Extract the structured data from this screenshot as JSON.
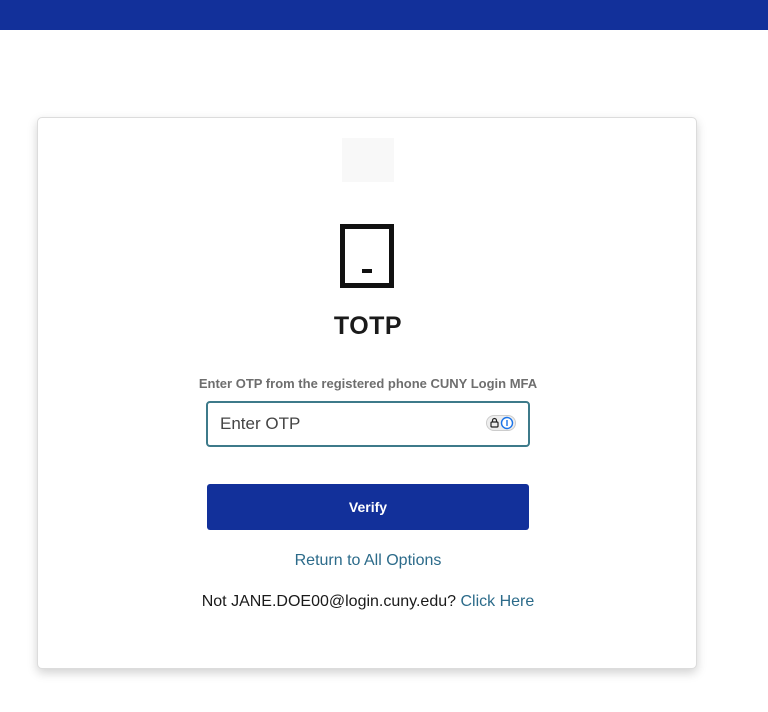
{
  "colors": {
    "brand": "#12309a",
    "link": "#2c6b8a",
    "input_border": "#3d7a8a"
  },
  "card": {
    "logo_icon": "blank-logo-placeholder",
    "device_icon": "tablet-phone-icon",
    "title": "TOTP",
    "instruction": "Enter OTP from the registered phone CUNY Login MFA",
    "otp_input": {
      "placeholder": "Enter OTP",
      "value": "",
      "icon": "password-manager-icon"
    },
    "verify_label": "Verify",
    "return_link": "Return to All Options",
    "not_user_prefix": "Not JANE.DOE00@login.cuny.edu?",
    "click_here_label": "Click Here"
  }
}
